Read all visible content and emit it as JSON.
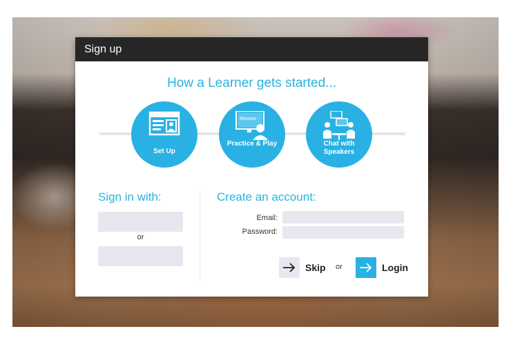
{
  "dialog": {
    "title": "Sign up",
    "headline": "How a Learner gets started..."
  },
  "steps": [
    {
      "label": "Set Up",
      "icon": "id-card-icon"
    },
    {
      "label": "Practice & Play",
      "icon": "monitor-user-icon",
      "screen_text": "Minowe"
    },
    {
      "label": "Chat with Speakers",
      "icon": "chat-people-icon"
    }
  ],
  "signin": {
    "title": "Sign in with:",
    "or": "or"
  },
  "create": {
    "title": "Create an account:",
    "email_label": "Email:",
    "password_label": "Password:",
    "email_value": "",
    "password_value": ""
  },
  "actions": {
    "skip_label": "Skip",
    "or": "or",
    "login_label": "Login"
  },
  "colors": {
    "accent": "#29b1e3",
    "titlebar": "#262626",
    "field": "#e7e8ef"
  }
}
